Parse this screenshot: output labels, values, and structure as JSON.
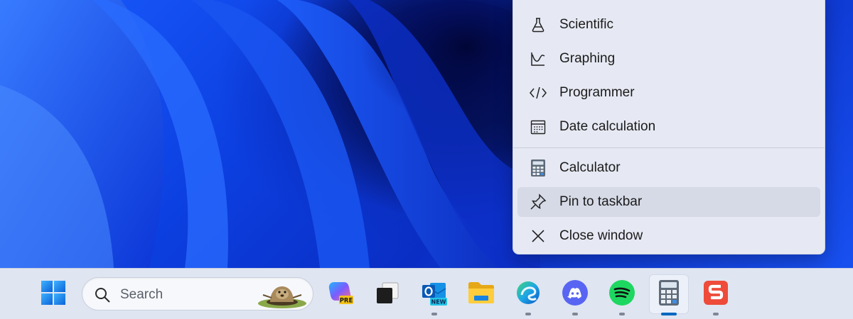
{
  "context_menu": {
    "items": [
      {
        "label": "Scientific",
        "icon": "flask-icon"
      },
      {
        "label": "Graphing",
        "icon": "graphing-icon"
      },
      {
        "label": "Programmer",
        "icon": "code-icon"
      },
      {
        "label": "Date calculation",
        "icon": "calendar-icon"
      },
      {
        "label": "Calculator",
        "icon": "calculator-icon"
      },
      {
        "label": "Pin to taskbar",
        "icon": "pin-icon",
        "hovered": true
      },
      {
        "label": "Close window",
        "icon": "close-icon"
      }
    ]
  },
  "taskbar": {
    "search": {
      "placeholder": "Search"
    },
    "apps": [
      {
        "name": "Start",
        "icon": "windows-start-icon"
      },
      {
        "name": "Copilot",
        "icon": "copilot-icon",
        "badge": "PRE"
      },
      {
        "name": "Task View",
        "icon": "task-view-icon"
      },
      {
        "name": "Outlook",
        "icon": "outlook-icon",
        "badge": "NEW",
        "running": true
      },
      {
        "name": "File Explorer",
        "icon": "folder-icon"
      },
      {
        "name": "Microsoft Edge",
        "icon": "edge-icon",
        "running": true
      },
      {
        "name": "Discord",
        "icon": "discord-icon",
        "running": true
      },
      {
        "name": "Spotify",
        "icon": "spotify-icon",
        "running": true
      },
      {
        "name": "Calculator",
        "icon": "calculator-icon",
        "running": true,
        "active": true
      },
      {
        "name": "WPS Office",
        "icon": "office-s-icon",
        "running": true
      }
    ]
  },
  "colors": {
    "accent": "#0067c0",
    "taskbar_bg": "#dfe5f1",
    "menu_bg": "#e6e9f3"
  }
}
